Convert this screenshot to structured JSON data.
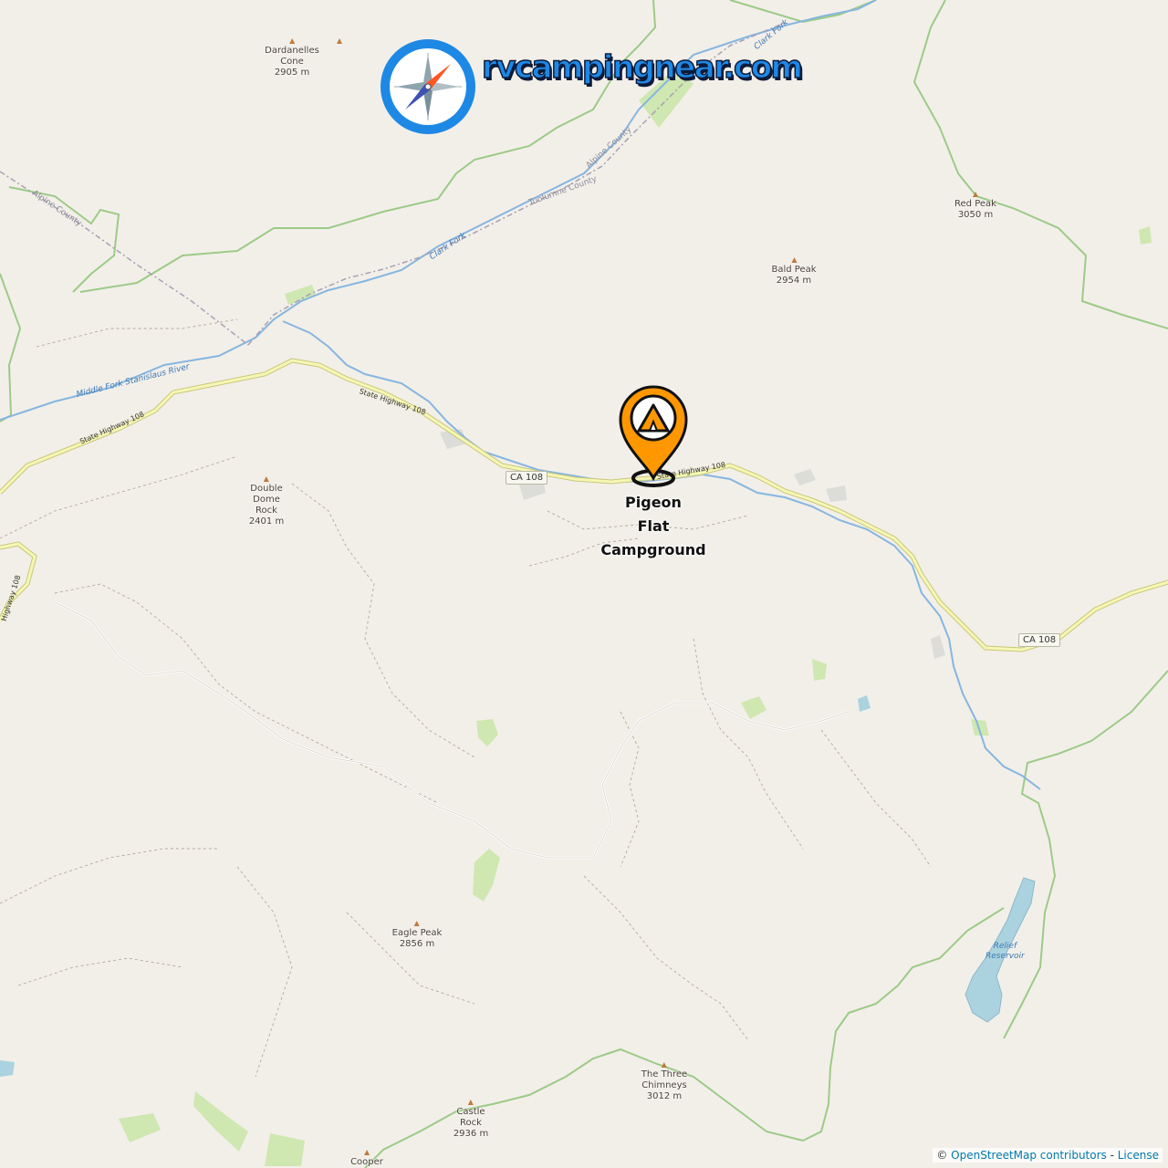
{
  "site": {
    "logo_text": "rvcampingnear.com"
  },
  "campground": {
    "name_lines": [
      "Pigeon",
      "Flat",
      "Campground"
    ]
  },
  "peaks": [
    {
      "name": "Dardanelles\nCone\n2905 m"
    },
    {
      "name": "Red Peak\n3050 m"
    },
    {
      "name": "Bald Peak\n2954 m"
    },
    {
      "name": "Double\nDome\nRock\n2401 m"
    },
    {
      "name": "Eagle Peak\n2856 m"
    },
    {
      "name": "The Three\nChimneys\n3012 m"
    },
    {
      "name": "Castle\nRock\n2936 m"
    },
    {
      "name": "Cooper"
    }
  ],
  "roads": {
    "shield_1": "CA 108",
    "shield_2": "CA 108",
    "label_1": "State Highway 108",
    "label_2": "State Highway 108",
    "label_3": "State Highway 108",
    "label_4": "State Highway 108",
    "label_5": "Highway 108"
  },
  "water": {
    "river_1": "Middle Fork Stanislaus River",
    "river_2": "Clark Fork",
    "river_3": "Clark Fork",
    "lake": "Relief\nReservoir"
  },
  "boundaries": {
    "b1": "Alpine County",
    "b2": "Alpine County",
    "b3": "Tuolumne County"
  },
  "attribution": {
    "prefix": "© ",
    "osm": "OpenStreetMap contributors",
    "sep": " - ",
    "license": "License"
  },
  "colors": {
    "background": "#f2efe9",
    "road": "#f6f6b5",
    "road_casing": "#c8c87a",
    "water": "#aad3df",
    "river": "#77a8cf",
    "park_border": "#8fc97a",
    "green": "#c8e6a8",
    "marker": "#ff9800",
    "logo": "#1e88e5"
  }
}
